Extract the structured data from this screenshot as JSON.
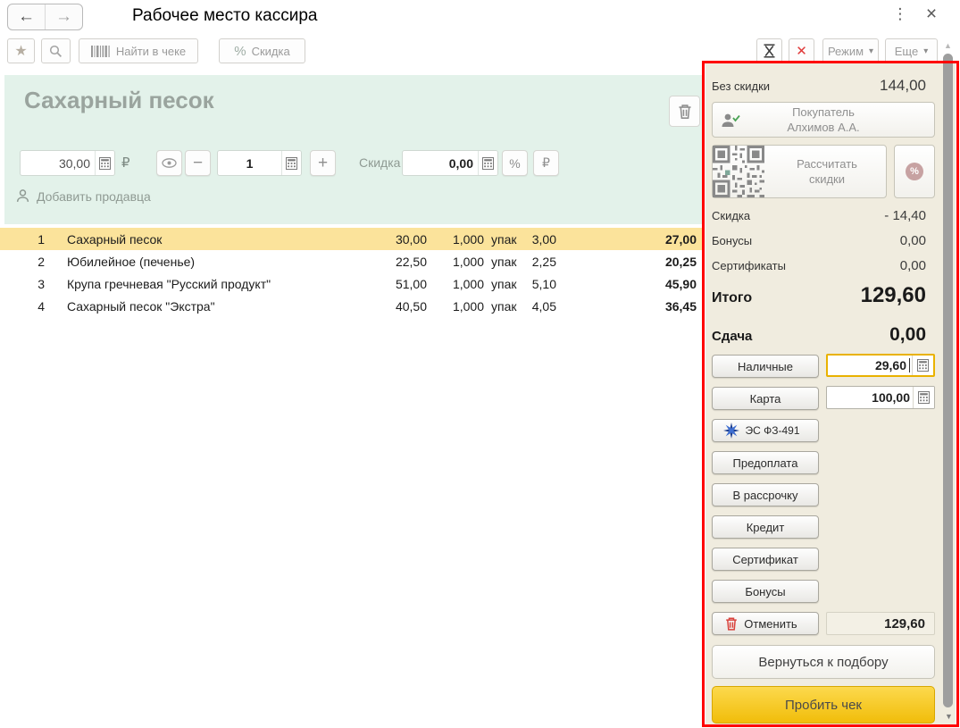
{
  "window": {
    "title": "Рабочее место кассира"
  },
  "icons": {
    "back": "←",
    "forward": "→",
    "menu_dots": "⋮",
    "close": "×",
    "star": "★",
    "dropdown": "▾",
    "red_x": "✕",
    "minus": "−",
    "plus": "+",
    "percent": "%",
    "ruble": "₽",
    "scroll_up": "▲",
    "scroll_down": "▼"
  },
  "toolbar": {
    "find_in_receipt": "Найти в чеке",
    "discount": "Скидка",
    "mode": "Режим",
    "more": "Еще"
  },
  "product": {
    "name": "Сахарный песок",
    "price": "30,00",
    "currency": "₽",
    "qty": "1",
    "discount_label": "Скидка",
    "discount_value": "0,00",
    "add_seller": "Добавить продавца"
  },
  "table": {
    "rows": [
      {
        "n": "1",
        "name": "Сахарный песок",
        "price": "30,00",
        "qty": "1,000",
        "unit": "упак",
        "disc": "3,00",
        "total": "27,00"
      },
      {
        "n": "2",
        "name": "Юбилейное (печенье)",
        "price": "22,50",
        "qty": "1,000",
        "unit": "упак",
        "disc": "2,25",
        "total": "20,25"
      },
      {
        "n": "3",
        "name": "Крупа гречневая \"Русский продукт\"",
        "price": "51,00",
        "qty": "1,000",
        "unit": "упак",
        "disc": "5,10",
        "total": "45,90"
      },
      {
        "n": "4",
        "name": "Сахарный песок \"Экстра\"",
        "price": "40,50",
        "qty": "1,000",
        "unit": "упак",
        "disc": "4,05",
        "total": "36,45"
      }
    ]
  },
  "panel": {
    "no_discount_label": "Без скидки",
    "no_discount_value": "144,00",
    "customer_line1": "Покупатель",
    "customer_line2": "Алхимов А.А.",
    "calc_discounts": "Рассчитать скидки",
    "info_rows": [
      {
        "label": "Скидка",
        "value": "- 14,40"
      },
      {
        "label": "Бонусы",
        "value": "0,00"
      },
      {
        "label": "Сертификаты",
        "value": "0,00"
      }
    ],
    "total_label": "Итого",
    "total_value": "129,60",
    "change_label": "Сдача",
    "change_value": "0,00",
    "cash_label": "Наличные",
    "cash_value": "29,60",
    "card_label": "Карта",
    "card_value": "100,00",
    "es_button": "ЭС ФЗ-491",
    "pay_methods": [
      "Предоплата",
      "В рассрочку",
      "Кредит",
      "Сертификат",
      "Бонусы"
    ],
    "cancel_label": "Отменить",
    "cancel_amount": "129,60",
    "return_button": "Вернуться к подбору",
    "commit_button": "Пробить чек"
  },
  "colors": {
    "panel_bg": "#f0ecdf",
    "green_bg": "#e3f2ea",
    "row_highlight": "#fbe39b",
    "commit_yellow": "#f1bd0a",
    "focus_orange": "#e9b200",
    "alert_red": "#ff0000"
  }
}
